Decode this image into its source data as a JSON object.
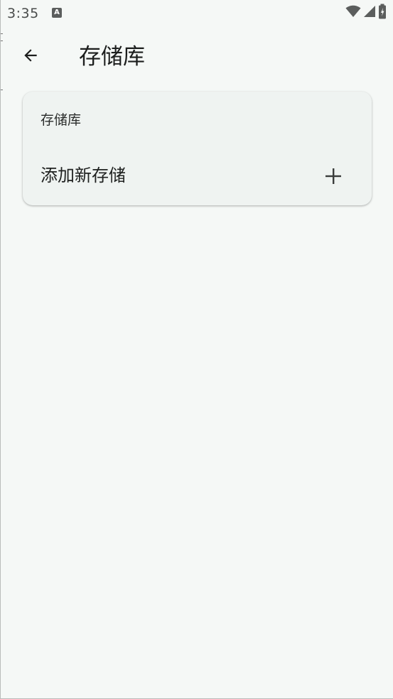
{
  "status_bar": {
    "time": "3:35",
    "app_icon_letter": "A",
    "icons": [
      "wifi-icon",
      "signal-icon",
      "battery-charging-icon"
    ]
  },
  "app_bar": {
    "back_icon": "arrow-back-icon",
    "title": "存储库"
  },
  "card": {
    "header": "存储库",
    "add_row": {
      "label": "添加新存储",
      "icon": "plus-icon"
    }
  },
  "colors": {
    "background": "#f5f8f6",
    "card": "#eff3f1",
    "text_primary": "#1c1e1d",
    "status_text": "#4a4d4c"
  }
}
